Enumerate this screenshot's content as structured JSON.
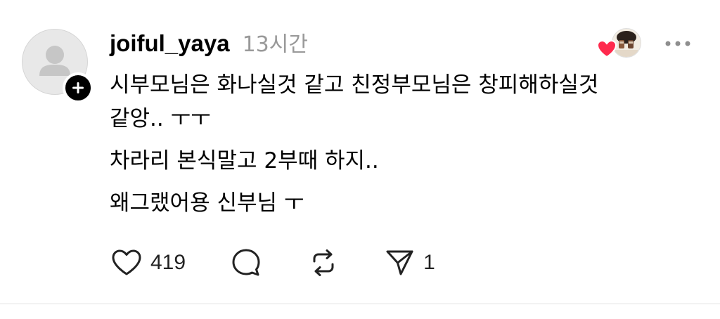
{
  "post": {
    "username": "joiful_yaya",
    "timestamp": "13시간",
    "content": {
      "lines": [
        "시부모님은 화나실것 같고 친정부모님은 창피해하실것",
        "같앙.. ㅜㅜ",
        "차라리 본식말고 2부때 하지..",
        "왜그랬어용 신부님 ㅜ"
      ]
    },
    "actions": {
      "like_count": "419",
      "share_count": "1"
    },
    "colors": {
      "heart_red": "#ff2a4d",
      "muted_text": "#999999"
    }
  }
}
